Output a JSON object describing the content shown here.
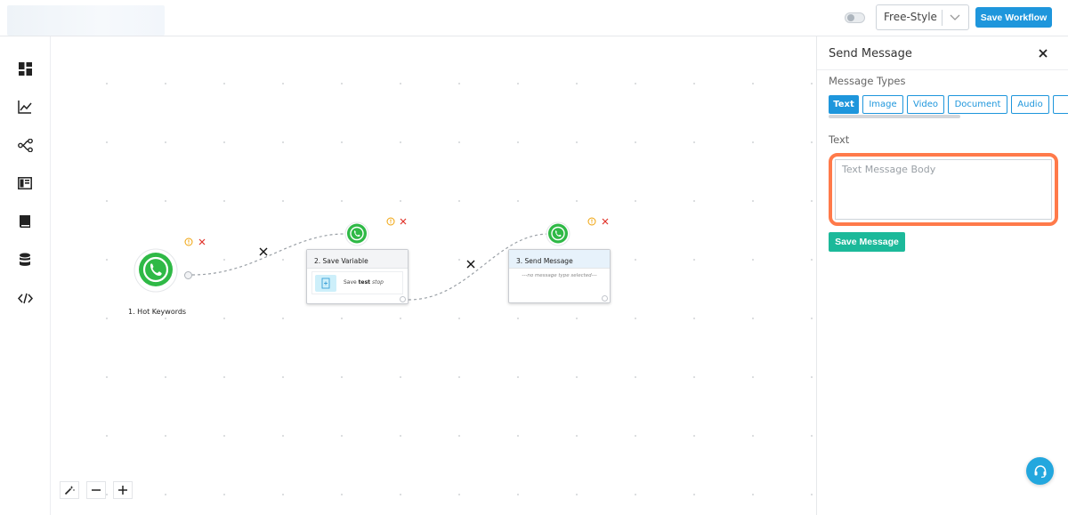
{
  "topbar": {
    "mode_select_value": "Free-Style",
    "save_workflow_label": "Save Workflow"
  },
  "sidebar": {
    "items": [
      {
        "icon": "dashboard-icon"
      },
      {
        "icon": "analytics-chart-icon"
      },
      {
        "icon": "workflow-share-icon"
      },
      {
        "icon": "template-layout-icon"
      },
      {
        "icon": "book-icon"
      },
      {
        "icon": "database-icon"
      },
      {
        "icon": "code-icon"
      }
    ]
  },
  "canvas": {
    "nodes": [
      {
        "label": "1. Hot Keywords",
        "icon": "whatsapp-icon"
      },
      {
        "title": "2. Save Variable",
        "body_prefix": "Save",
        "body_bold": "test",
        "body_italic": "stop",
        "icon": "whatsapp-icon"
      },
      {
        "title": "3. Send Message",
        "empty_text": "---no message type selected---",
        "icon": "whatsapp-icon"
      }
    ]
  },
  "panel": {
    "title": "Send Message",
    "message_types_label": "Message Types",
    "tabs": [
      "Text",
      "Image",
      "Video",
      "Document",
      "Audio"
    ],
    "active_tab": "Text",
    "text_label": "Text",
    "text_placeholder": "Text Message Body",
    "save_message_label": "Save Message"
  },
  "colors": {
    "primary": "#1e96dc",
    "success": "#1cb99a",
    "highlight": "#ff7a4a",
    "whatsapp": "#25d366"
  }
}
